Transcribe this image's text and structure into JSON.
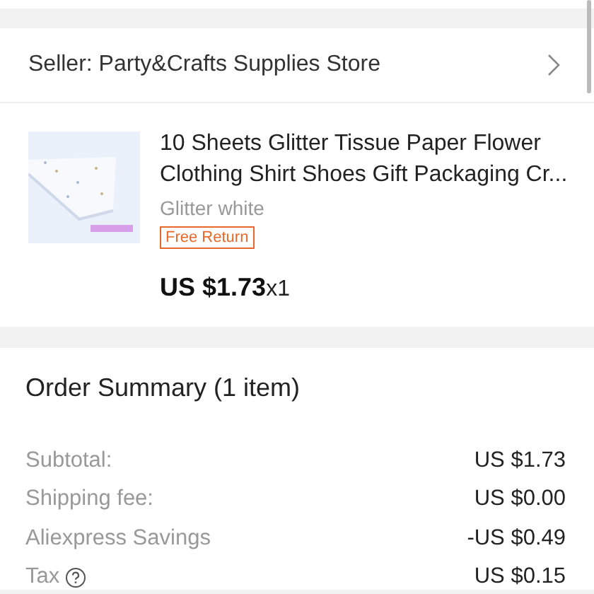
{
  "seller": {
    "label": "Seller: Party&Crafts Supplies Store"
  },
  "product": {
    "title": "10 Sheets Glitter Tissue Paper Flower Clothing Shirt Shoes Gift Packaging Cr...",
    "variant": "Glitter white",
    "badge": "Free Return",
    "price": "US $1.73",
    "quantity": "x1"
  },
  "order_summary": {
    "title": "Order Summary (1 item)",
    "rows": [
      {
        "label": "Subtotal:",
        "value": "US $1.73",
        "help_icon": false
      },
      {
        "label": "Shipping fee:",
        "value": "US $0.00",
        "help_icon": false
      },
      {
        "label": "Aliexpress Savings",
        "value": "-US $0.49",
        "help_icon": false
      },
      {
        "label": "Tax",
        "value": "US $0.15",
        "help_icon": true
      }
    ]
  }
}
